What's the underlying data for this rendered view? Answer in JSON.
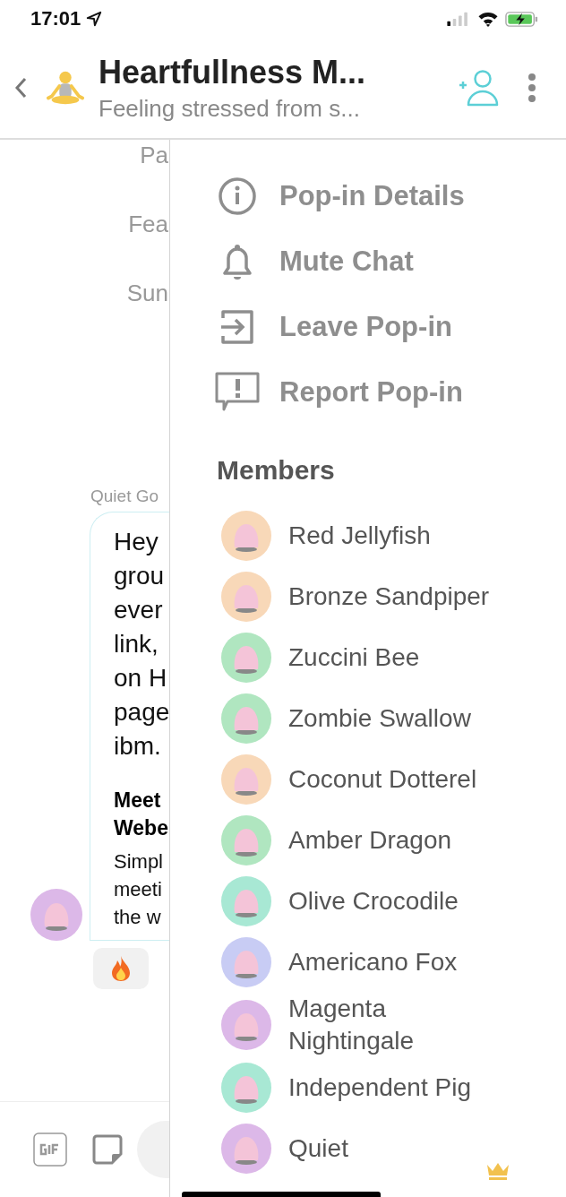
{
  "status_bar": {
    "time": "17:01"
  },
  "header": {
    "title": "Heartfullness M...",
    "subtitle": "Feeling stressed from s..."
  },
  "chat": {
    "fragments": [
      "Pa",
      "Fea",
      "Sun"
    ],
    "sender": "Quiet Go",
    "message_lines": [
      "Hey",
      "grou",
      "ever",
      "link,",
      "on H",
      "page",
      "ibm."
    ],
    "link_title_lines": [
      "Meet",
      "Webe"
    ],
    "link_text_lines": [
      "Simpl",
      "meeti",
      "the w"
    ]
  },
  "menu": [
    {
      "kind": "info",
      "label": "Pop-in Details"
    },
    {
      "kind": "bell",
      "label": "Mute Chat"
    },
    {
      "kind": "leave",
      "label": "Leave Pop-in"
    },
    {
      "kind": "report",
      "label": "Report Pop-in"
    }
  ],
  "members_heading": "Members",
  "members": [
    {
      "name": "Red Jellyfish",
      "color": "#f8d8b8",
      "owner": false
    },
    {
      "name": "Bronze Sandpiper",
      "color": "#f8d8b8",
      "owner": false
    },
    {
      "name": "Zuccini Bee",
      "color": "#b0e6c0",
      "owner": false
    },
    {
      "name": "Zombie Swallow",
      "color": "#b0e6c0",
      "owner": false
    },
    {
      "name": "Coconut Dotterel",
      "color": "#f8d8b8",
      "owner": false
    },
    {
      "name": "Amber Dragon",
      "color": "#b0e6c0",
      "owner": false
    },
    {
      "name": "Olive Crocodile",
      "color": "#a8e8d4",
      "owner": false
    },
    {
      "name": "Americano Fox",
      "color": "#c8ccf4",
      "owner": false
    },
    {
      "name": "Magenta Nightingale",
      "color": "#dcb8e8",
      "owner": false
    },
    {
      "name": "Independent Pig",
      "color": "#a8e8d4",
      "owner": false
    },
    {
      "name": "Quiet",
      "color": "#dcb8e8",
      "owner": true
    }
  ]
}
